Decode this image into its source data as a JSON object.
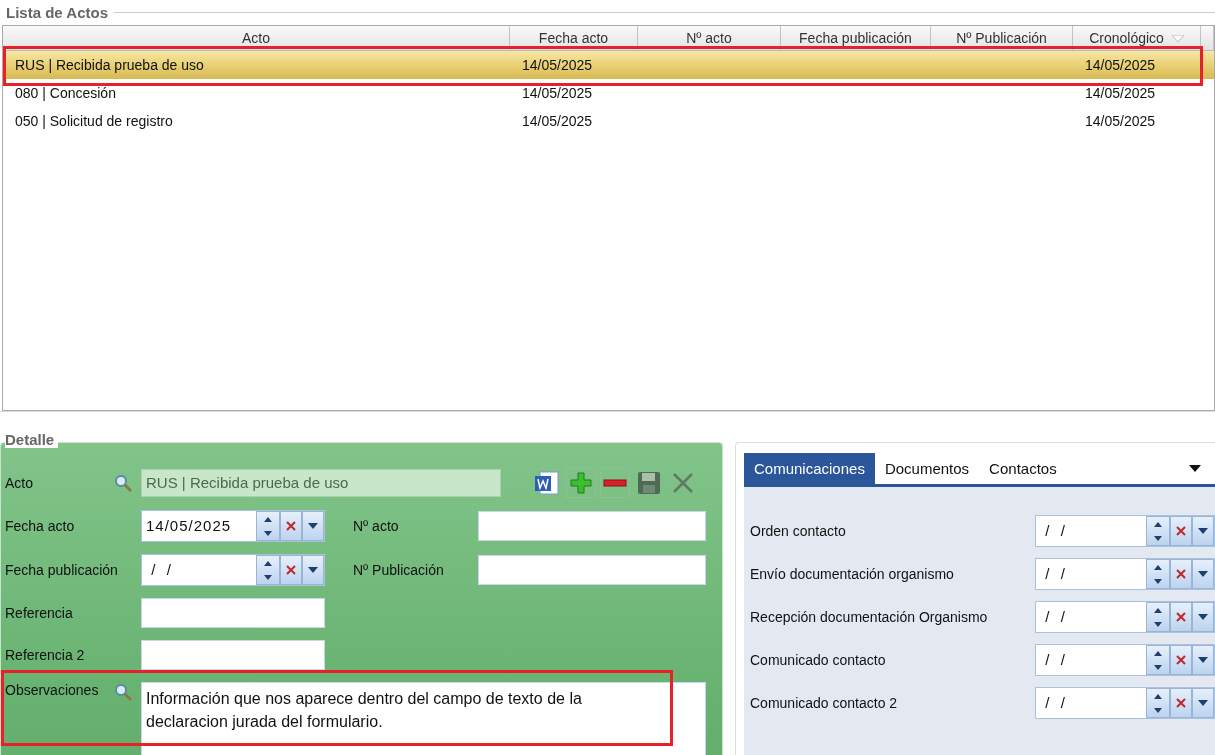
{
  "list": {
    "title": "Lista de Actos",
    "columns": [
      {
        "label": "Acto",
        "sorted": false
      },
      {
        "label": "Fecha acto",
        "sorted": false
      },
      {
        "label": "Nº acto",
        "sorted": false
      },
      {
        "label": "Fecha publicación",
        "sorted": false
      },
      {
        "label": "Nº Publicación",
        "sorted": false
      },
      {
        "label": "Cronológico",
        "sorted": true
      }
    ],
    "rows": [
      {
        "cells": [
          "RUS | Recibida prueba de uso",
          "14/05/2025",
          "",
          "",
          "",
          "14/05/2025"
        ],
        "selected": true,
        "highlighted": true
      },
      {
        "cells": [
          "080 | Concesión",
          "14/05/2025",
          "",
          "",
          "",
          "14/05/2025"
        ],
        "selected": false,
        "highlighted": false
      },
      {
        "cells": [
          "050 | Solicitud de registro",
          "14/05/2025",
          "",
          "",
          "",
          "14/05/2025"
        ],
        "selected": false,
        "highlighted": false
      }
    ]
  },
  "detail": {
    "title": "Detalle",
    "acto": {
      "label": "Acto",
      "value": "RUS | Recibida prueba de uso"
    },
    "rows": [
      {
        "label": "Fecha acto",
        "kind": "date",
        "value": "14/05/2025",
        "side": {
          "label": "Nº acto",
          "kind": "text"
        }
      },
      {
        "label": "Fecha publicación",
        "kind": "date",
        "value": " /  /",
        "side": {
          "label": "Nº Publicación",
          "kind": "text"
        }
      },
      {
        "label": "Referencia",
        "kind": "text"
      },
      {
        "label": "Referencia 2",
        "kind": "text"
      }
    ],
    "observaciones": {
      "label": "Observaciones",
      "value": "Información que nos aparece dentro del campo de texto de la declaracion jurada del formulario.",
      "highlighted": true
    }
  },
  "side_panel": {
    "tabs": [
      {
        "label": "Comunicaciones",
        "selected": true
      },
      {
        "label": "Documentos",
        "selected": false
      },
      {
        "label": "Contactos",
        "selected": false
      }
    ],
    "fields": [
      {
        "label": "Orden contacto",
        "value": " /  /"
      },
      {
        "label": "Envío documentación organismo",
        "value": " /  /"
      },
      {
        "label": "Recepción documentación Organismo",
        "value": " /  /"
      },
      {
        "label": "Comunicado contacto",
        "value": " /  /"
      },
      {
        "label": "Comunicado contacto 2",
        "value": " /  /"
      }
    ]
  }
}
